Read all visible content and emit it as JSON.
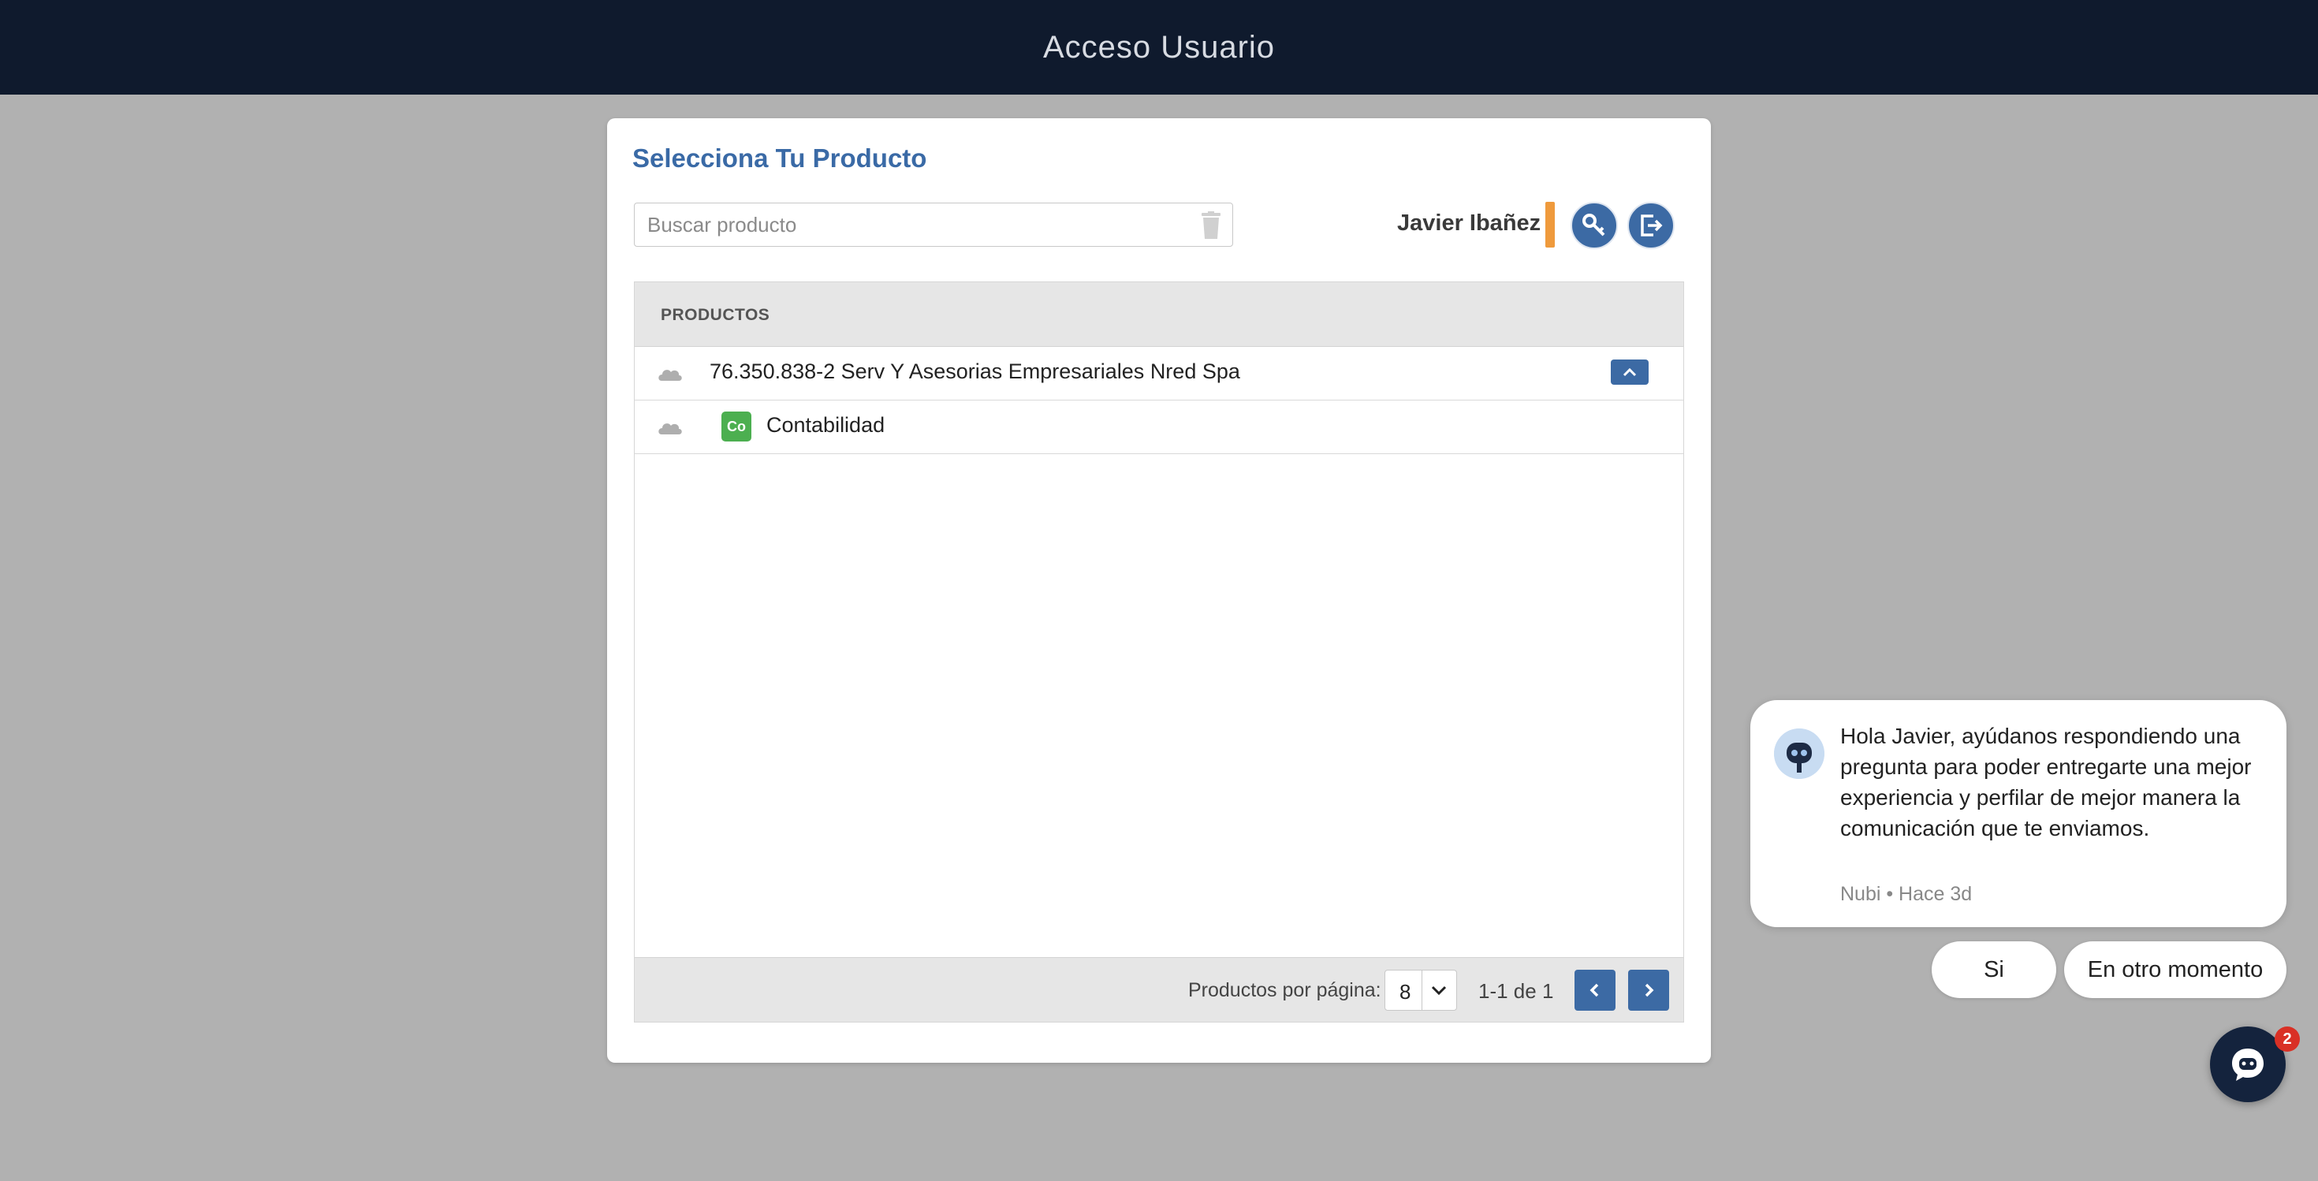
{
  "header": {
    "title": "Acceso Usuario"
  },
  "card": {
    "title": "Selecciona Tu Producto",
    "search": {
      "placeholder": "Buscar producto",
      "value": ""
    },
    "user": {
      "name": "Javier Ibañez"
    },
    "icons": {
      "clear_search": "trash-icon",
      "change_password": "key-icon",
      "logout": "logout-icon"
    },
    "colors": {
      "accent": "#3c6aa4",
      "user_marker": "#ef9a3c",
      "product_badge": "#4caf50",
      "header_bg": "#0f1a2d"
    }
  },
  "table": {
    "header": "PRODUCTOS",
    "rows": [
      {
        "label": "76.350.838-2 Serv Y Asesorias Empresariales Nred Spa",
        "icon": "cloud-icon",
        "expanded": true
      },
      {
        "label": "Contabilidad",
        "icon": "cloud-icon",
        "badge": "Co"
      }
    ],
    "footer": {
      "per_page_label": "Productos por página:",
      "per_page_value": "8",
      "range": "1-1 de 1"
    }
  },
  "chat": {
    "message": "Hola Javier, ayúdanos respondiendo una pregunta para poder entregarte una mejor experiencia y perfilar de mejor manera la comunicación que te enviamos.",
    "meta": "Nubi • Hace 3d",
    "options": [
      "Si",
      "En otro momento"
    ],
    "unread_count": "2"
  }
}
